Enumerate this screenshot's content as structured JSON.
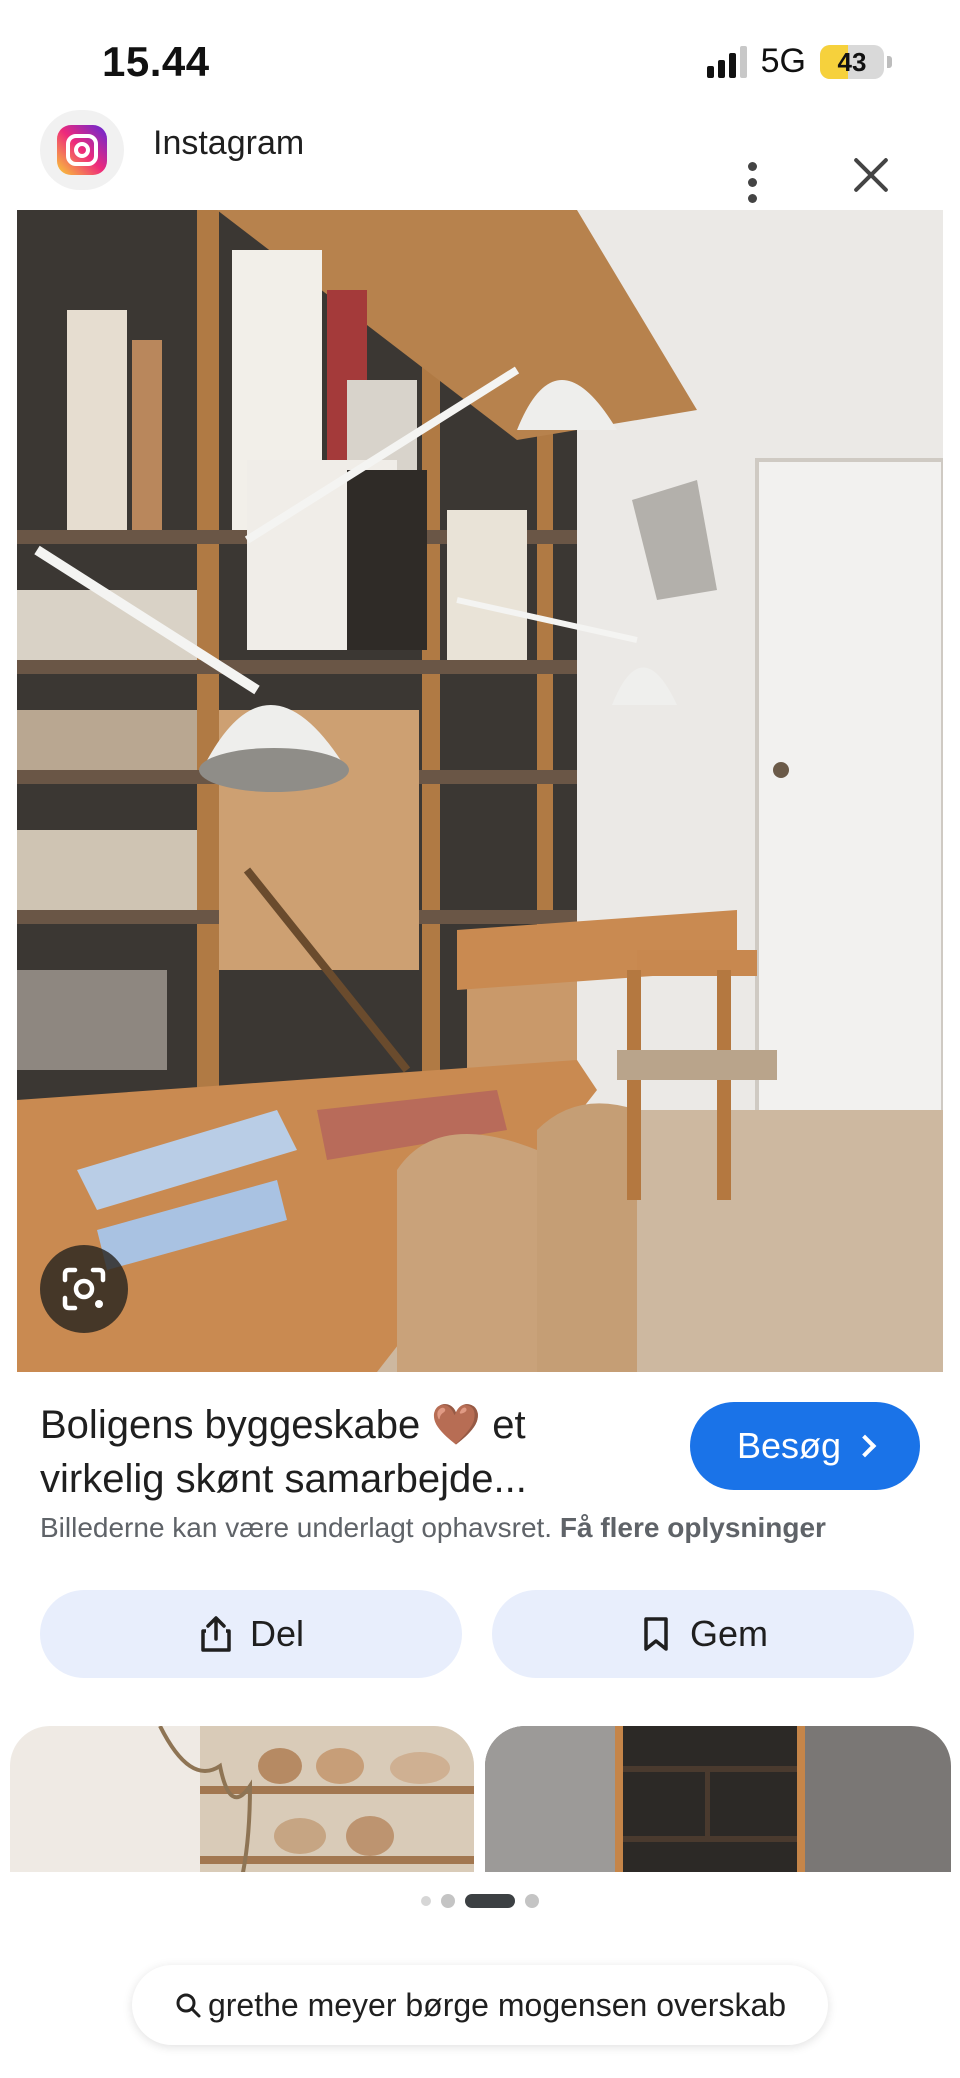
{
  "status_bar": {
    "time": "15.44",
    "network": "5G",
    "battery_level": "43",
    "battery_fraction": 0.43,
    "signal_bars_active": 3,
    "signal_bars_total": 4
  },
  "header": {
    "source_name": "Instagram",
    "source_icon": "instagram-logo",
    "more_icon": "more-vert-icon",
    "close_icon": "close-icon"
  },
  "main_image": {
    "lens_icon": "google-lens-icon"
  },
  "result": {
    "title_line1": "Boligens byggeskabe 🤎 et",
    "title_line2": "virkelig skønt samarbejde...",
    "visit_label": "Besøg",
    "copyright_text": "Billederne kan være underlagt ophavsret.",
    "more_info_link": "Få flere oplysninger"
  },
  "actions": {
    "share_label": "Del",
    "save_label": "Gem"
  },
  "pager": {
    "count": 4,
    "active_index": 2
  },
  "search": {
    "query": "grethe meyer børge mogensen overskab"
  },
  "colors": {
    "accent": "#1a73e8",
    "action_bg": "#e8eefc",
    "battery": "#f6d13c"
  }
}
